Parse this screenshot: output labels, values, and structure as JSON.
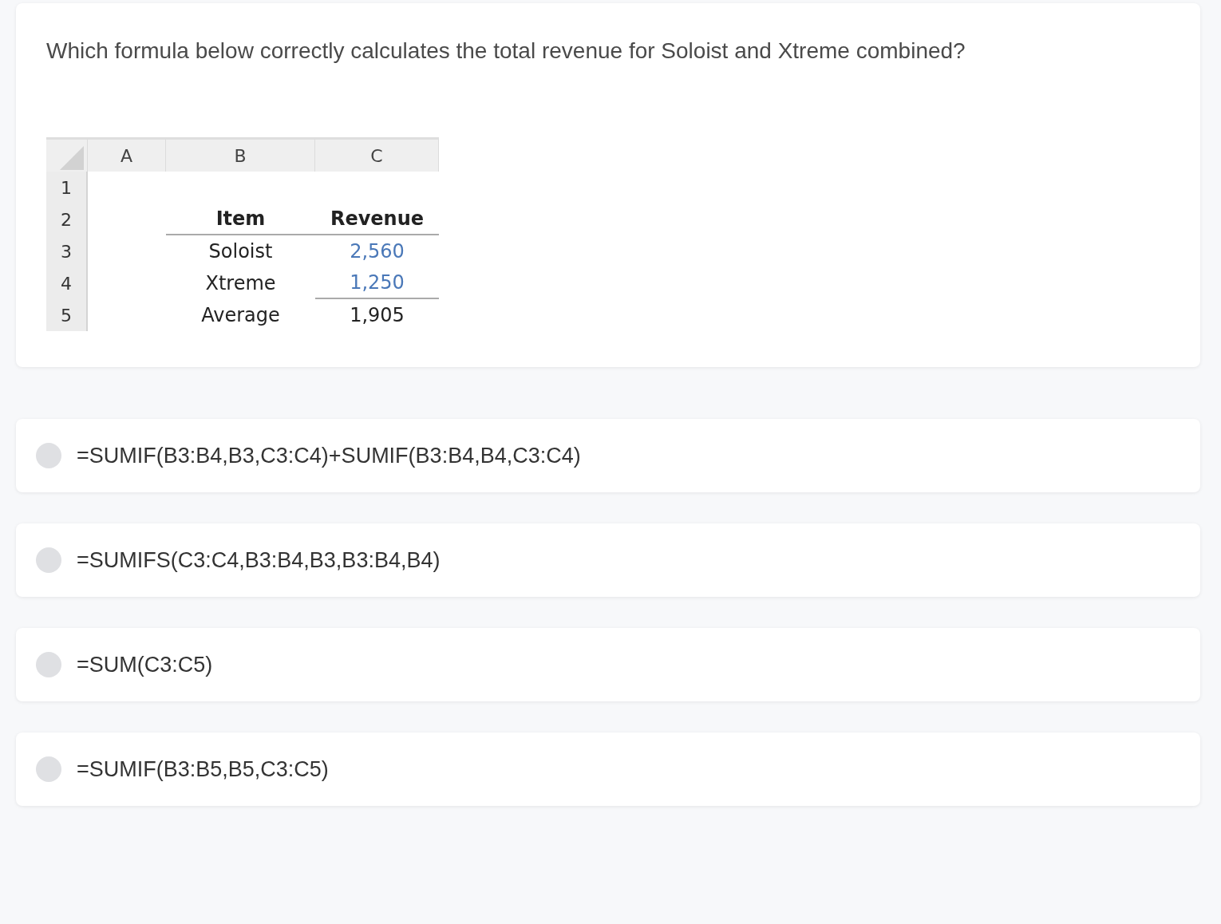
{
  "question": "Which formula below correctly calculates the total revenue for Soloist and Xtreme combined?",
  "spreadsheet": {
    "columns": [
      "A",
      "B",
      "C"
    ],
    "rows": [
      {
        "number": "1",
        "kind": "blank"
      },
      {
        "number": "2",
        "kind": "header",
        "item": "Item",
        "revenue": "Revenue"
      },
      {
        "number": "3",
        "kind": "input",
        "item": "Soloist",
        "revenue": "2,560"
      },
      {
        "number": "4",
        "kind": "input_last",
        "item": "Xtreme",
        "revenue": "1,250"
      },
      {
        "number": "5",
        "kind": "result",
        "item": "Average",
        "revenue": "1,905"
      }
    ]
  },
  "options": [
    {
      "label": "=SUMIF(B3:B4,B3,C3:C4)+SUMIF(B3:B4,B4,C3:C4)",
      "selected": false
    },
    {
      "label": "=SUMIFS(C3:C4,B3:B4,B3,B3:B4,B4)",
      "selected": false
    },
    {
      "label": "=SUM(C3:C5)",
      "selected": false
    },
    {
      "label": "=SUMIF(B3:B5,B5,C3:C5)",
      "selected": false
    }
  ]
}
